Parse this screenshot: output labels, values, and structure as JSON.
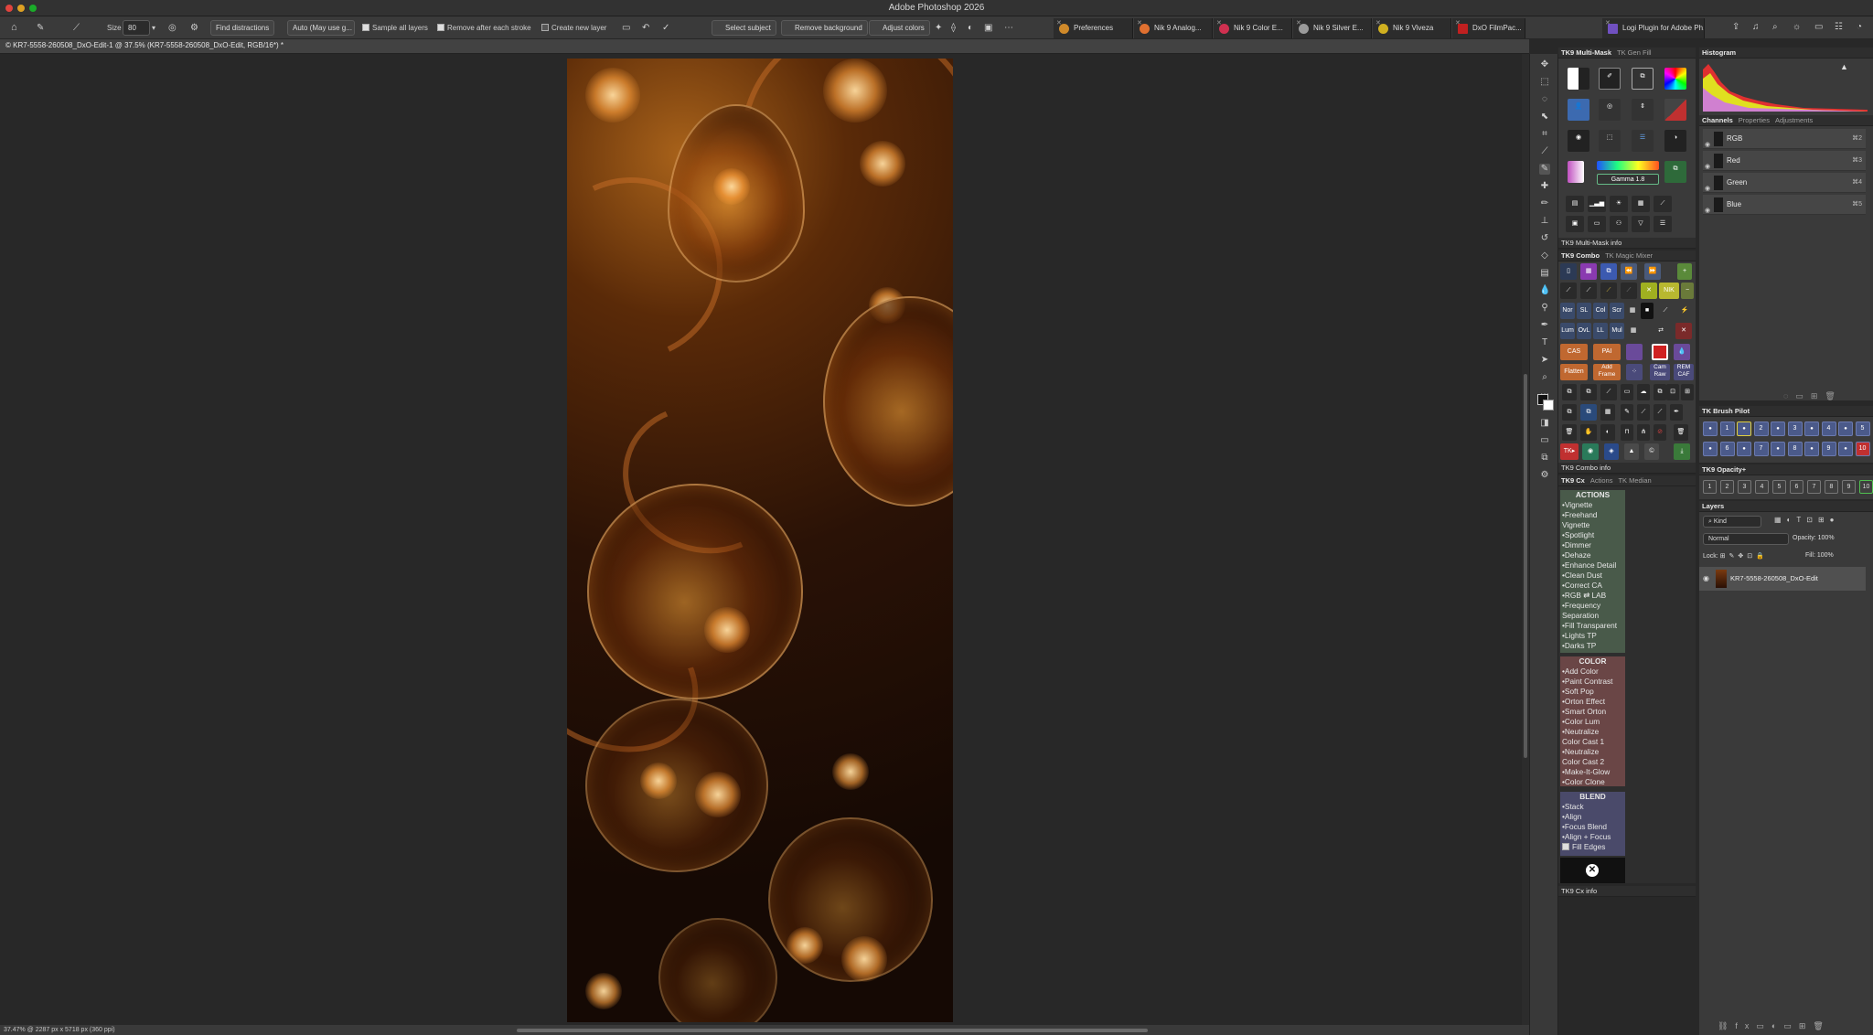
{
  "window": {
    "title": "Adobe Photoshop 2026"
  },
  "options_bar": {
    "size_label": "Size",
    "size_value": "80",
    "find_distractions": "Find distractions",
    "mode_select": "Auto (May use g...",
    "sample_all_layers": "Sample all layers",
    "remove_after_stroke": "Remove after each stroke",
    "create_new_layer": "Create new layer",
    "select_subject": "Select subject",
    "remove_background": "Remove background",
    "adjust_colors": "Adjust colors"
  },
  "plugin_tabs": [
    {
      "label": "Preferences",
      "color": "#d08a2a"
    },
    {
      "label": "Nik 9 Analog...",
      "color": "#e07030"
    },
    {
      "label": "Nik 9 Color E...",
      "color": "#d03050"
    },
    {
      "label": "Nik 9 Silver E...",
      "color": "#9a9a9a"
    },
    {
      "label": "Nik 9 Viveza",
      "color": "#d0b020"
    },
    {
      "label": "DxO FilmPac...",
      "color": "#c02020"
    },
    {
      "label": "Logi Plugin for Adobe Ph...",
      "color": "#7050c0"
    }
  ],
  "document": {
    "tab_title": "© KR7-5558-260508_DxO-Edit-1 @ 37.5% (KR7-5558-260508_DxO-Edit, RGB/16*) *",
    "status": "37.47% @ 2287 px x 5718 px (360 ppi)"
  },
  "panels": {
    "multimask": {
      "title": "TK9 Multi-Mask",
      "tab2": "TK Gen Fill",
      "gamma": "Gamma 1.8",
      "info": "TK9 Multi-Mask info"
    },
    "combo": {
      "title": "TK9 Combo",
      "tab2": "TK Magic Mixer",
      "info": "TK9 Combo info",
      "row_small": [
        "Nor",
        "SL",
        "Col",
        "Scr"
      ],
      "row_small2": [
        "Lum",
        "OvL",
        "LL",
        "Mul"
      ],
      "cas": "CAS",
      "pai": "PAI",
      "flatten": "Flatten",
      "add_frame": "Add Frame",
      "cam_raw": "Cam Raw",
      "rem_caf": "REM CAF"
    },
    "cx": {
      "title": "TK9 Cx",
      "tab2": "Actions",
      "tab3": "TK Median",
      "info": "TK9 Cx info"
    },
    "histogram": {
      "title": "Histogram"
    },
    "channels": {
      "tab1": "Channels",
      "tab2": "Properties",
      "tab3": "Adjustments",
      "rows": [
        {
          "name": "RGB",
          "shortcut": "⌘2"
        },
        {
          "name": "Red",
          "shortcut": "⌘3"
        },
        {
          "name": "Green",
          "shortcut": "⌘4"
        },
        {
          "name": "Blue",
          "shortcut": "⌘5"
        }
      ]
    },
    "brush_pilot": {
      "title": "TK Brush Pilot",
      "row1": [
        "",
        "1",
        "",
        "2",
        "",
        "3",
        "",
        "4",
        "",
        "5"
      ],
      "row2": [
        "",
        "6",
        "",
        "7",
        "",
        "8",
        "",
        "9",
        "",
        "10"
      ]
    },
    "opacity": {
      "title": "TK9 Opacity+",
      "values": [
        "1",
        "2",
        "3",
        "4",
        "5",
        "6",
        "7",
        "8",
        "9",
        "10"
      ]
    },
    "layers": {
      "title": "Layers",
      "kind": "Kind",
      "blend": "Normal",
      "opacity_label": "Opacity:",
      "opacity": "100%",
      "lock_label": "Lock:",
      "fill_label": "Fill:",
      "fill": "100%",
      "layer_name": "KR7-5558-260508_DxO-Edit"
    }
  },
  "actions": {
    "actions_header": "ACTIONS",
    "actions": [
      "•Vignette",
      "•Freehand",
      "  Vignette",
      "•Spotlight",
      "•Dimmer",
      "•Dehaze",
      "•Enhance Detail",
      "•Clean Dust",
      "•Correct CA",
      "•RGB ⇄ LAB",
      "•Frequency",
      "  Separation",
      "•Fill Transparent",
      "•Lights TP",
      "•Darks TP"
    ],
    "color_header": "COLOR",
    "color": [
      "•Add Color",
      "•Paint Contrast",
      "•Soft Pop",
      "•Orton Effect",
      "•Smart Orton",
      "•Color Lum",
      "•Neutralize",
      "  Color Cast 1",
      "•Neutralize",
      "  Color Cast 2",
      "•Make-It-Glow",
      "•Color Clone"
    ],
    "blend_header": "BLEND",
    "blend": [
      "•Stack",
      "•Align",
      "•Focus Blend",
      "•Align + Focus"
    ],
    "fill_edges": "Fill Edges"
  }
}
